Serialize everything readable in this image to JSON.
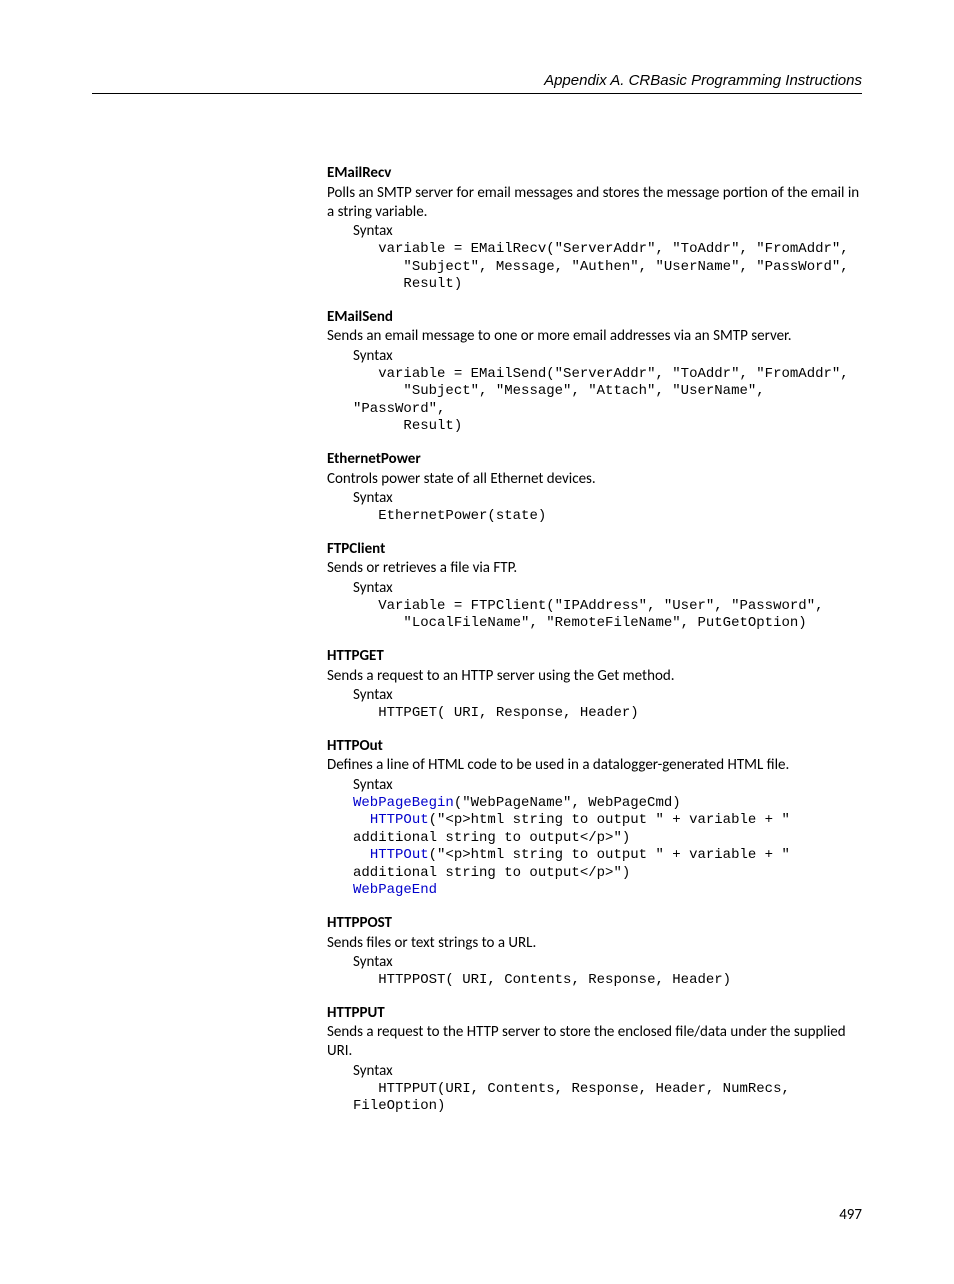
{
  "header": "Appendix A.  CRBasic Programming Instructions",
  "pagenum": "497",
  "entries": [
    {
      "title": "EMailRecv",
      "desc": "Polls an SMTP server for email messages and stores the message portion of the email in a string variable.",
      "syntaxLabel": "Syntax",
      "code": "   variable = EMailRecv(\"ServerAddr\", \"ToAddr\", \"FromAddr\",\n      \"Subject\", Message, \"Authen\", \"UserName\", \"PassWord\",\n      Result)"
    },
    {
      "title": "EMailSend",
      "desc": "Sends an email message to one or more email addresses via an SMTP server.",
      "syntaxLabel": "Syntax",
      "code": "   variable = EMailSend(\"ServerAddr\", \"ToAddr\", \"FromAddr\",\n      \"Subject\", \"Message\", \"Attach\", \"UserName\", \"PassWord\",\n      Result)"
    },
    {
      "title": "EthernetPower",
      "desc": "Controls power state of all Ethernet devices.",
      "syntaxLabel": "Syntax",
      "code": "   EthernetPower(state)"
    },
    {
      "title": "FTPClient",
      "desc": "Sends or retrieves a file via FTP.",
      "syntaxLabel": "Syntax",
      "code": "   Variable = FTPClient(\"IPAddress\", \"User\", \"Password\",\n      \"LocalFileName\", \"RemoteFileName\", PutGetOption)"
    },
    {
      "title": "HTTPGET",
      "desc": "Sends a request to an HTTP server using the Get method.",
      "syntaxLabel": "Syntax",
      "code": "   HTTPGET( URI, Response, Header)"
    },
    {
      "title": "HTTPOut",
      "desc": "Defines a line of HTML code to be used in a datalogger-generated HTML file.",
      "syntaxLabel": "Syntax",
      "codeParts": [
        {
          "kw": true,
          "text": "WebPageBegin"
        },
        {
          "kw": false,
          "text": "(\"WebPageName\", WebPageCmd)\n  "
        },
        {
          "kw": true,
          "text": "HTTPOut"
        },
        {
          "kw": false,
          "text": "(\"<p>html string to output \" + variable + \" additional string to output</p>\")\n  "
        },
        {
          "kw": true,
          "text": "HTTPOut"
        },
        {
          "kw": false,
          "text": "(\"<p>html string to output \" + variable + \" additional string to output</p>\")\n"
        },
        {
          "kw": true,
          "text": "WebPageEnd"
        }
      ]
    },
    {
      "title": "HTTPPOST",
      "desc": "Sends files or text strings to a URL.",
      "syntaxLabel": "Syntax",
      "code": "   HTTPPOST( URI, Contents, Response, Header)"
    },
    {
      "title": "HTTPPUT",
      "desc": "Sends a request to the HTTP server to store the enclosed file/data under the supplied URI.",
      "syntaxLabel": "Syntax",
      "code": "   HTTPPUT(URI, Contents, Response, Header, NumRecs, FileOption)"
    }
  ]
}
